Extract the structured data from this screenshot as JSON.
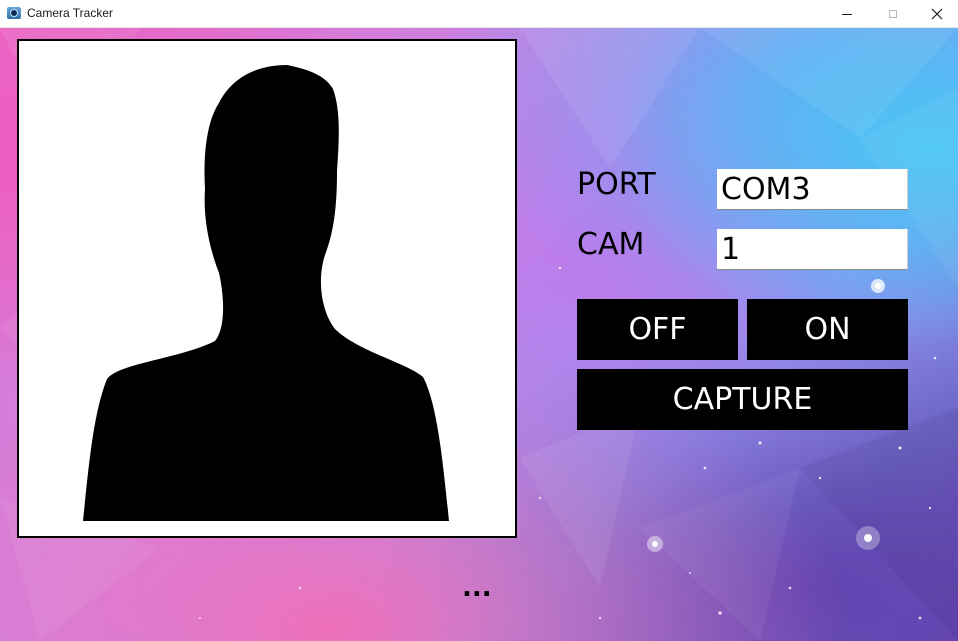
{
  "window": {
    "title": "Camera Tracker",
    "icon": "camera-app-icon",
    "controls": {
      "minimize_icon": "minimize-icon",
      "maximize_icon": "maximize-icon",
      "close_icon": "close-icon"
    }
  },
  "photo": {
    "placeholder_icon": "person-silhouette"
  },
  "form": {
    "port_label": "PORT",
    "port_value": "COM3",
    "cam_label": "CAM",
    "cam_value": "1"
  },
  "buttons": {
    "off_label": "OFF",
    "on_label": "ON",
    "capture_label": "CAPTURE"
  },
  "status": {
    "text": "..."
  },
  "colors": {
    "button_bg": "#000000",
    "button_text": "#ffffff",
    "frame_border": "#000000",
    "titlebar_bg": "#ffffff"
  }
}
